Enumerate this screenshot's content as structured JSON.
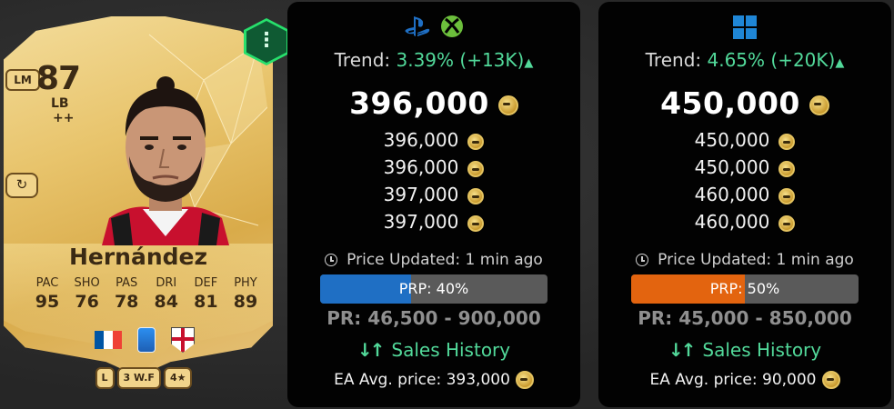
{
  "card": {
    "rating": "87",
    "position": "LM",
    "alt_position": "LB",
    "alt_plus": "++",
    "name": "Hernández",
    "stats": [
      {
        "label": "PAC",
        "value": "95"
      },
      {
        "label": "SHO",
        "value": "76"
      },
      {
        "label": "PAS",
        "value": "78"
      },
      {
        "label": "DRI",
        "value": "84"
      },
      {
        "label": "DEF",
        "value": "81"
      },
      {
        "label": "PHY",
        "value": "89"
      }
    ],
    "foot_chip": "L",
    "weak_foot_chip": "3 W.F",
    "skill_chip": "4★",
    "menu_icon": "vertical-dots-icon"
  },
  "panels": [
    {
      "platforms": [
        "playstation-icon",
        "xbox-icon"
      ],
      "trend_label": "Trend:",
      "trend_value": "3.39% (+13K)",
      "main_price": "396,000",
      "prices": [
        "396,000",
        "396,000",
        "397,000",
        "397,000"
      ],
      "updated": "Price Updated: 1 min ago",
      "prp_label": "PRP: 40%",
      "prp_fraction": 0.4,
      "prp_color": "#1f6fc4",
      "pr_range": "PR: 46,500 - 900,000",
      "sales_history": "Sales History",
      "ea_avg": "EA Avg. price: 393,000"
    },
    {
      "platforms": [
        "windows-icon"
      ],
      "trend_label": "Trend:",
      "trend_value": "4.65% (+20K)",
      "main_price": "450,000",
      "prices": [
        "450,000",
        "450,000",
        "460,000",
        "460,000"
      ],
      "updated": "Price Updated: 1 min ago",
      "prp_label": "PRP: 50%",
      "prp_fraction": 0.5,
      "prp_color": "#e3640f",
      "pr_range": "PR: 45,000 - 850,000",
      "sales_history": "Sales History",
      "ea_avg": "EA Avg. price: 90,000"
    }
  ],
  "colors": {
    "trend_green": "#52d99a",
    "panel_bg": "#020202",
    "card_gold": "#e8c46c"
  }
}
